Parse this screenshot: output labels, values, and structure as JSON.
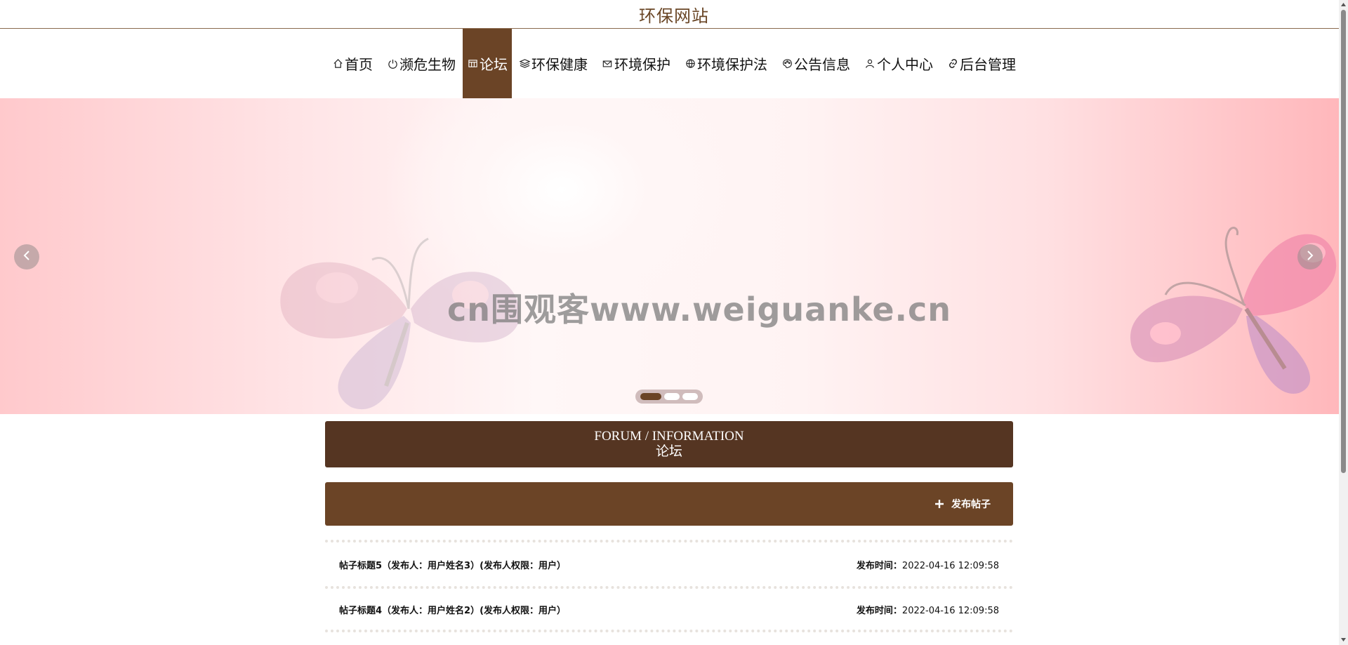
{
  "site": {
    "title": "环保网站"
  },
  "nav": {
    "items": [
      {
        "label": "首页",
        "icon": "home-icon"
      },
      {
        "label": "濒危生物",
        "icon": "power-icon"
      },
      {
        "label": "论坛",
        "icon": "forum-icon",
        "active": true
      },
      {
        "label": "环保健康",
        "icon": "layers-icon"
      },
      {
        "label": "环境保护",
        "icon": "mail-icon"
      },
      {
        "label": "环境保护法",
        "icon": "globe-icon"
      },
      {
        "label": "公告信息",
        "icon": "palette-icon"
      },
      {
        "label": "个人中心",
        "icon": "user-icon"
      },
      {
        "label": "后台管理",
        "icon": "link-icon"
      }
    ]
  },
  "banner": {
    "watermark": "cn围观客www.weiguanke.cn",
    "slide_count": 3,
    "active_slide": 1
  },
  "section": {
    "title_en": "FORUM / INFORMATION",
    "title_zh": "论坛"
  },
  "actions": {
    "publish_label": "发布帖子"
  },
  "posts": [
    {
      "title": "帖子标题5（发布人：用户姓名3）(发布人权限：用户）",
      "time_label": "发布时间：",
      "time": "2022-04-16 12:09:58"
    },
    {
      "title": "帖子标题4（发布人：用户姓名2）(发布人权限：用户）",
      "time_label": "发布时间：",
      "time": "2022-04-16 12:09:58"
    }
  ],
  "colors": {
    "brand_dark": "#553522",
    "brand": "#6b4426",
    "title_text": "#6a4626"
  }
}
